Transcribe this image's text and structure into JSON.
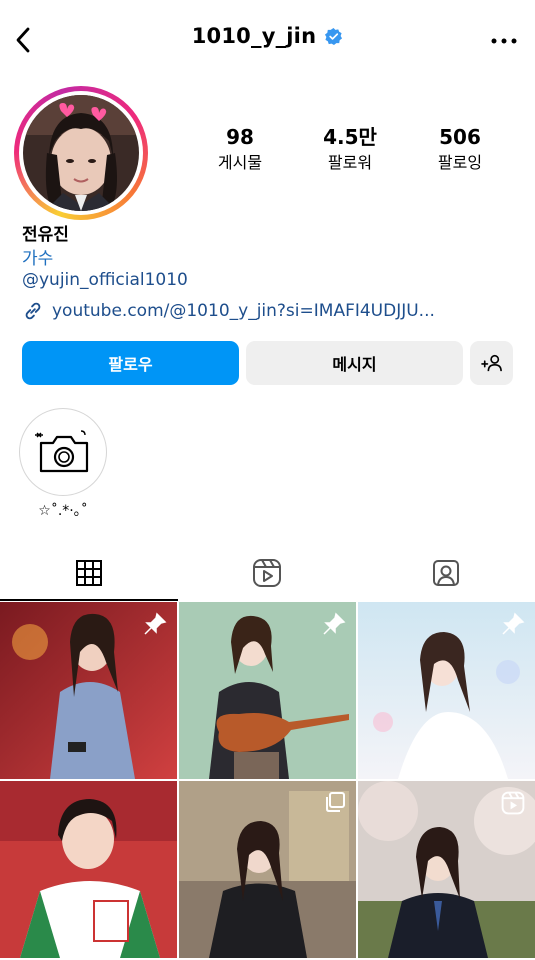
{
  "header": {
    "username": "1010_y_jin",
    "back_icon": "chevron-left-icon",
    "verified_icon": "verified-badge-icon",
    "more_icon": "more-horizontal-icon"
  },
  "stats": [
    {
      "value": "98",
      "label": "게시물"
    },
    {
      "value": "4.5만",
      "label": "팔로워"
    },
    {
      "value": "506",
      "label": "팔로잉"
    }
  ],
  "bio": {
    "name": "전유진",
    "category": "가수",
    "handle": "@yujin_official1010",
    "link": "youtube.com/@1010_y_jin?si=IMAFI4UDJJU..."
  },
  "buttons": {
    "follow": "팔로우",
    "message": "메시지"
  },
  "highlights": [
    {
      "label": "☆˚.*·｡˚"
    }
  ],
  "tabs": [
    "grid-icon",
    "reels-icon",
    "tagged-icon"
  ],
  "grid": {
    "cells": [
      {
        "overlay": "pin-icon"
      },
      {
        "overlay": "pin-icon"
      },
      {
        "overlay": "pin-icon"
      },
      {
        "overlay": ""
      },
      {
        "overlay": "multi-post-icon"
      },
      {
        "overlay": "reels-icon"
      }
    ]
  },
  "colors": {
    "accent": "#0095f6",
    "verified": "#3897f0",
    "link": "#1e4e8c",
    "button_gray": "#efefef"
  }
}
